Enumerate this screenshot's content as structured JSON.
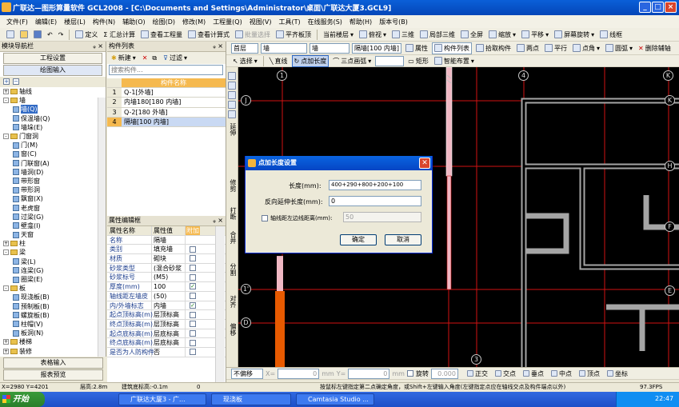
{
  "window": {
    "title": "广联达—图形算量软件 GCL2008 - [C:\\Documents and Settings\\Administrator\\桌面\\广联达大厦3.GCL9]",
    "min_label": "_",
    "max_label": "□",
    "close_label": "×"
  },
  "menu": [
    "文件(F)",
    "编辑(E)",
    "楼层(L)",
    "构件(N)",
    "辅助(O)",
    "绘图(D)",
    "修改(M)",
    "工程量(Q)",
    "视图(V)",
    "工具(T)",
    "在线服务(S)",
    "帮助(H)",
    "版本号(B)"
  ],
  "toolbar1": {
    "define": "定义",
    "calc": "Σ 汇总计算",
    "view_qty": "查看工程量",
    "view_formula": "查看计算式",
    "batch_select": "批量选择",
    "flush_slab": "平齐板顶",
    "layer": "当前楼层",
    "view3d": "俯视",
    "three_d": "三维",
    "local3d": "局部三维",
    "fullscreen": "全屏",
    "zoom": "缩放",
    "pan": "平移",
    "rotate": "屏幕旋转",
    "wireframe": "线框"
  },
  "toolbar2": {
    "floor": "首层",
    "category": "墙",
    "type": "墙",
    "component": "隔墙[100 内墙]",
    "property": "属性",
    "comp_list": "构件列表",
    "pick": "拾取构件",
    "two_points": "两点",
    "parallel": "平行",
    "point_angle": "点角",
    "arc": "圆弧",
    "delete_aux": "删除辅轴"
  },
  "toolbar3": {
    "select": "选择",
    "line": "直线",
    "point_length": "点加长度",
    "three_arc": "三点画弧",
    "rect": "矩形",
    "smart": "智能布置"
  },
  "nav": {
    "title": "模块导航栏",
    "project_settings": "工程设置",
    "draw_input": "绘图输入",
    "table_input": "表格输入",
    "report": "报表预览",
    "tree": [
      {
        "label": "轴线",
        "level": 0,
        "kind": "folder",
        "exp": "+"
      },
      {
        "label": "墙",
        "level": 0,
        "kind": "folder",
        "exp": "-"
      },
      {
        "label": "墙(Q)",
        "level": 1,
        "kind": "leaf"
      },
      {
        "label": "保温墙(Q)",
        "level": 1,
        "kind": "leaf"
      },
      {
        "label": "墙垛(E)",
        "level": 1,
        "kind": "leaf"
      },
      {
        "label": "门窗洞",
        "level": 0,
        "kind": "folder",
        "exp": "-"
      },
      {
        "label": "门(M)",
        "level": 1,
        "kind": "leaf"
      },
      {
        "label": "窗(C)",
        "level": 1,
        "kind": "leaf"
      },
      {
        "label": "门联窗(A)",
        "level": 1,
        "kind": "leaf"
      },
      {
        "label": "墙洞(D)",
        "level": 1,
        "kind": "leaf"
      },
      {
        "label": "带形窗",
        "level": 1,
        "kind": "leaf"
      },
      {
        "label": "带形洞",
        "level": 1,
        "kind": "leaf"
      },
      {
        "label": "飘窗(X)",
        "level": 1,
        "kind": "leaf"
      },
      {
        "label": "老虎窗",
        "level": 1,
        "kind": "leaf"
      },
      {
        "label": "过梁(G)",
        "level": 1,
        "kind": "leaf"
      },
      {
        "label": "壁龛(I)",
        "level": 1,
        "kind": "leaf"
      },
      {
        "label": "天窗",
        "level": 1,
        "kind": "leaf"
      },
      {
        "label": "柱",
        "level": 0,
        "kind": "folder",
        "exp": "+"
      },
      {
        "label": "梁",
        "level": 0,
        "kind": "folder",
        "exp": "-"
      },
      {
        "label": "梁(L)",
        "level": 1,
        "kind": "leaf"
      },
      {
        "label": "连梁(G)",
        "level": 1,
        "kind": "leaf"
      },
      {
        "label": "圈梁(E)",
        "level": 1,
        "kind": "leaf"
      },
      {
        "label": "板",
        "level": 0,
        "kind": "folder",
        "exp": "-"
      },
      {
        "label": "现浇板(B)",
        "level": 1,
        "kind": "leaf"
      },
      {
        "label": "预制板(B)",
        "level": 1,
        "kind": "leaf"
      },
      {
        "label": "螺旋板(B)",
        "level": 1,
        "kind": "leaf"
      },
      {
        "label": "柱帽(V)",
        "level": 1,
        "kind": "leaf"
      },
      {
        "label": "板洞(N)",
        "level": 1,
        "kind": "leaf"
      },
      {
        "label": "楼梯",
        "level": 0,
        "kind": "folder",
        "exp": "+"
      },
      {
        "label": "装修",
        "level": 0,
        "kind": "folder",
        "exp": "+"
      },
      {
        "label": "土方",
        "level": 0,
        "kind": "folder",
        "exp": "+"
      },
      {
        "label": "基础",
        "level": 0,
        "kind": "folder",
        "exp": "+"
      }
    ]
  },
  "comp_list": {
    "title": "构件列表",
    "new_label": "新建",
    "filter_label": "过滤",
    "search_placeholder": "搜索构件...",
    "header": "构件名称",
    "rows": [
      {
        "num": "1",
        "name": "Q-1[外墙]"
      },
      {
        "num": "2",
        "name": "内墙180[180 内墙]"
      },
      {
        "num": "3",
        "name": "Q-2[180 外墙]"
      },
      {
        "num": "4",
        "name": "隔墙[100 内墙]"
      }
    ]
  },
  "props": {
    "title": "属性编辑框",
    "headers": [
      "属性名称",
      "属性值",
      "附加"
    ],
    "rows": [
      {
        "name": "名称",
        "value": "隔墙",
        "checked": false,
        "hasbox": false
      },
      {
        "name": "类别",
        "value": "填充墙",
        "checked": false,
        "hasbox": true
      },
      {
        "name": "材质",
        "value": "砌块",
        "checked": false,
        "hasbox": true
      },
      {
        "name": "砂浆类型",
        "value": "(混合砂浆",
        "checked": false,
        "hasbox": true
      },
      {
        "name": "砂浆标号",
        "value": "(M5)",
        "checked": false,
        "hasbox": true
      },
      {
        "name": "厚度(mm)",
        "value": "100",
        "checked": true,
        "hasbox": true
      },
      {
        "name": "轴线距左墙皮",
        "value": "(50)",
        "checked": false,
        "hasbox": true
      },
      {
        "name": "内/外墙标志",
        "value": "内墙",
        "checked": true,
        "hasbox": true
      },
      {
        "name": "起点顶标高(m)",
        "value": "层顶标高",
        "checked": false,
        "hasbox": true
      },
      {
        "name": "终点顶标高(m)",
        "value": "层顶标高",
        "checked": false,
        "hasbox": true
      },
      {
        "name": "起点底标高(m)",
        "value": "层底标高",
        "checked": false,
        "hasbox": true
      },
      {
        "name": "终点底标高(m)",
        "value": "层底标高",
        "checked": false,
        "hasbox": true
      },
      {
        "name": "是否为人防构件",
        "value": "否",
        "checked": false,
        "hasbox": true
      }
    ]
  },
  "vtool": [
    "延伸",
    "修剪",
    "打断",
    "合并",
    "分割",
    "对齐",
    "偏移"
  ],
  "axes": {
    "top": [
      "1",
      "4",
      "K"
    ],
    "left": [
      "J",
      "1'",
      "D"
    ],
    "bottom": [
      "3"
    ],
    "right_top": "K",
    "right_mid": "H",
    "right_low": "F",
    "right_bot": "E"
  },
  "dialog": {
    "title": "点加长度设置",
    "length_label": "长度(mm):",
    "length_value": "400+290+800+200+100",
    "reverse_label": "反向延伸长度(mm):",
    "reverse_value": "0",
    "axis_offset_label": "轴线距左边线距离(mm):",
    "axis_offset_value": "50",
    "ok": "确定",
    "cancel": "取消"
  },
  "statusbar": {
    "no_offset": "不偏移",
    "x_label": "X=",
    "x_value": "0",
    "y_label": "Y=",
    "y_value": "0",
    "unit": "mm",
    "rotate_label": "旋转",
    "rotate_value": "0.000",
    "snaps": [
      "正交",
      "交点",
      "垂点",
      "中点",
      "顶点",
      "坐标"
    ]
  },
  "bottom_status": {
    "coords": "X=2980 Y=4201",
    "layer_height": "层高:2.8m",
    "base_elev": "建筑底标高:-0.1m",
    "zero": "0",
    "hint": "按鼠标左键指定第二点确定角度，或Shift+左键输入角度(左键指定点应在轴线交点及构件端点以外)",
    "fps": "97.3FPS"
  },
  "taskbar": {
    "start": "开始",
    "tasks": [
      "广联达大厦3 - 广...",
      "现浇板",
      "Camtasia Studio ..."
    ],
    "time": "22:47"
  },
  "colors": {
    "wall_gray": "#a5a5a5",
    "wall_pink": "#f0b8c4",
    "wall_orange": "#e85a00",
    "axis_red": "#d21212",
    "selected_row": "#c9d9f3"
  }
}
